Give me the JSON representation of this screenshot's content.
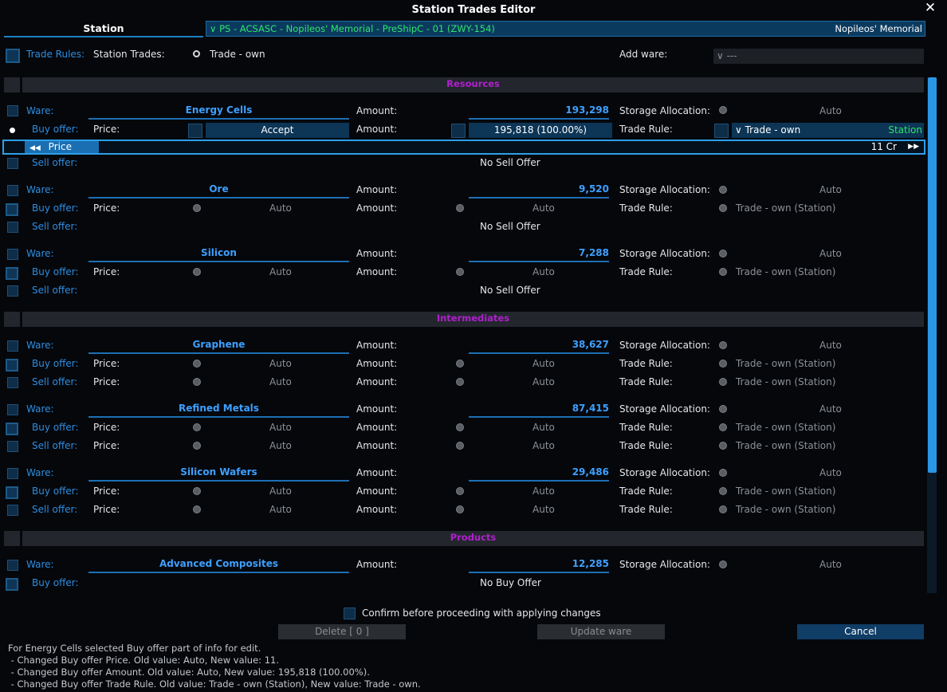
{
  "window": {
    "title": "Station Trades Editor",
    "close": "✕"
  },
  "header": {
    "tab": "Station",
    "selector_left": "PS - ACSASC - Nopileos' Memorial - PreShipC - 01 (ZWY-154)",
    "selector_right": "Nopileos' Memorial",
    "chevron": "∨"
  },
  "toolbar": {
    "trade_rules_label": "Trade Rules:",
    "station_trades_label": "Station Trades:",
    "station_trades_value": "Trade - own",
    "add_ware_label": "Add ware:",
    "add_ware_value": "∨ ---"
  },
  "labels": {
    "ware": "Ware:",
    "buy_offer": "Buy offer:",
    "sell_offer": "Sell offer:",
    "price": "Price:",
    "amount": "Amount:",
    "storage_allocation": "Storage Allocation:",
    "trade_rule": "Trade Rule:",
    "auto": "Auto",
    "trade_own_station": "Trade - own (Station)",
    "no_sell_offer": "No Sell Offer",
    "no_buy_offer": "No Buy Offer"
  },
  "sections": {
    "resources": "Resources",
    "intermediates": "Intermediates",
    "products": "Products"
  },
  "wares": {
    "energy_cells": {
      "name": "Energy Cells",
      "amount": "193,298",
      "buy_price_button": "Accept",
      "buy_amount_value": "195,818 (100.00%)",
      "buy_trade_rule": "∨ Trade - own",
      "buy_trade_rule_scope": "Station",
      "price_slider_label": "Price",
      "price_slider_value": "11 Cr"
    },
    "ore": {
      "name": "Ore",
      "amount": "9,520"
    },
    "silicon": {
      "name": "Silicon",
      "amount": "7,288"
    },
    "graphene": {
      "name": "Graphene",
      "amount": "38,627"
    },
    "refined_metals": {
      "name": "Refined Metals",
      "amount": "87,415"
    },
    "silicon_wafers": {
      "name": "Silicon Wafers",
      "amount": "29,486"
    },
    "advanced_composites": {
      "name": "Advanced Composites",
      "amount": "12,285"
    }
  },
  "footer": {
    "confirm_label": "Confirm before proceeding with applying changes",
    "delete_button": "Delete [ 0 ]",
    "update_button": "Update ware",
    "cancel_button": "Cancel",
    "log": [
      "For Energy Cells selected Buy offer part of info for edit.",
      " - Changed Buy offer Price. Old value: Auto, New value: 11.",
      " - Changed Buy offer Amount. Old value: Auto, New value: 195,818 (100.00%).",
      " - Changed Buy offer Trade Rule. Old value: Trade - own (Station), New value: Trade - own."
    ]
  },
  "colors": {
    "accent": "#2e8de0",
    "section_title": "#b11fce",
    "selector_text": "#2ee56b",
    "value_text": "#3ea0ff"
  }
}
